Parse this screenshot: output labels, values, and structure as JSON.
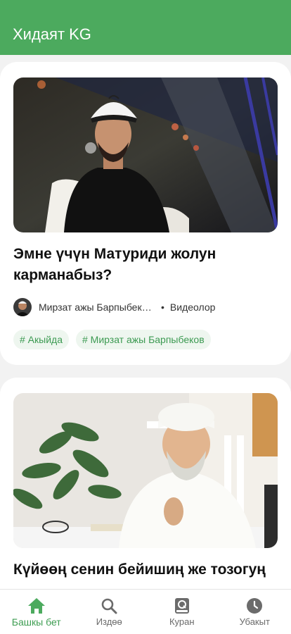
{
  "appbar": {
    "title": "Хидаят KG"
  },
  "posts": [
    {
      "title": "Эмне үчүн Матуриди жолун карманабыз?",
      "author": "Мирзат ажы Барпыбеко...",
      "separator": "•",
      "category": "Видеолор",
      "tags": [
        "# Акыйда",
        "# Мирзат ажы Барпыбеков"
      ]
    },
    {
      "title": "Күйөөң сенин бейишиң же тозогуң"
    }
  ],
  "nav": {
    "home": "Башкы бет",
    "search": "Издөө",
    "quran": "Куран",
    "time": "Убакыт"
  },
  "colors": {
    "brand": "#4caa5e",
    "tag_bg": "#eef6ef",
    "tag_text": "#3c9a52"
  }
}
